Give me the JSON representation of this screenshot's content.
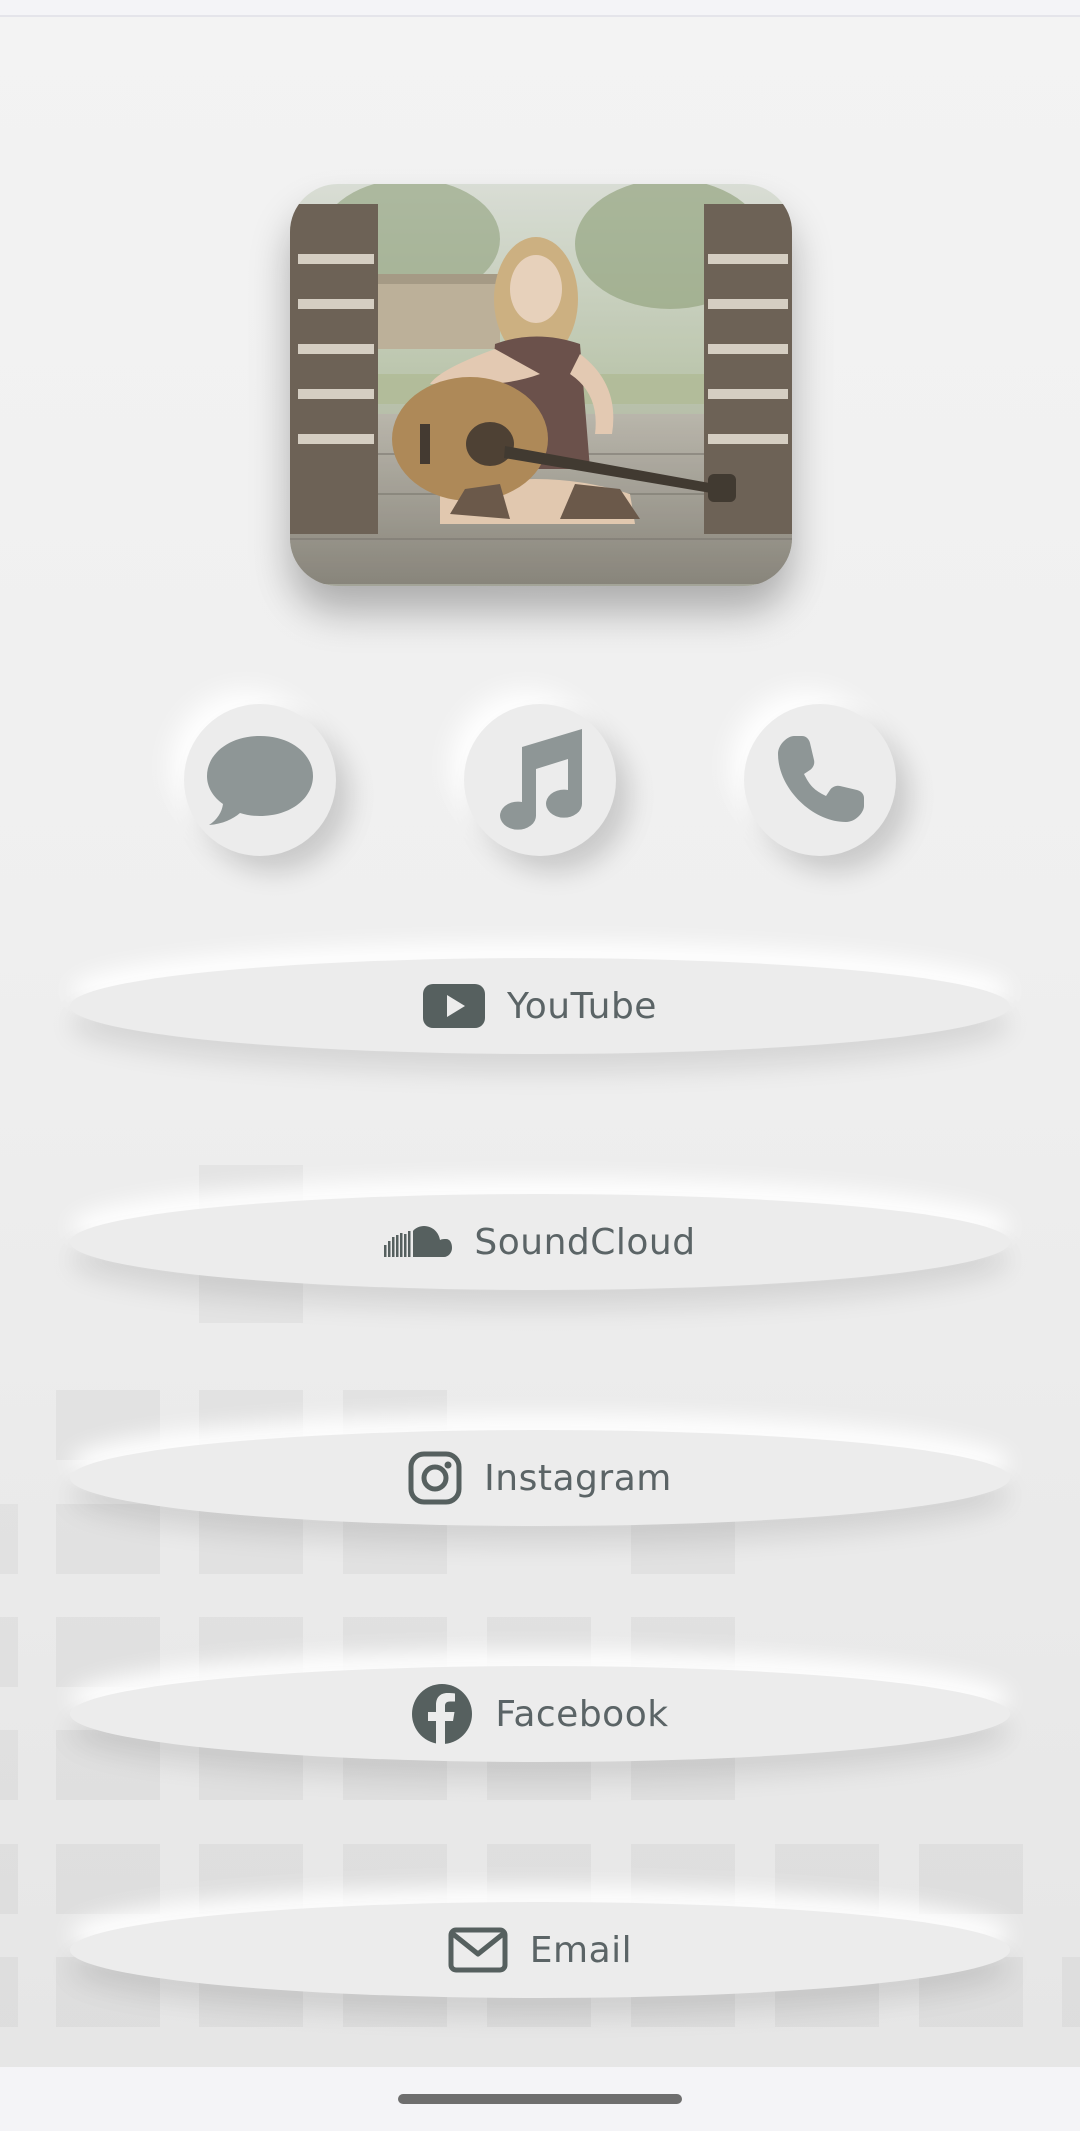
{
  "contact_buttons": [
    {
      "icon": "chat-bubble-icon"
    },
    {
      "icon": "music-note-icon"
    },
    {
      "icon": "phone-icon"
    }
  ],
  "links": [
    {
      "label": "YouTube",
      "icon": "youtube-icon"
    },
    {
      "label": "SoundCloud",
      "icon": "soundcloud-icon"
    },
    {
      "label": "Instagram",
      "icon": "instagram-icon"
    },
    {
      "label": "Facebook",
      "icon": "facebook-icon"
    },
    {
      "label": "Email",
      "icon": "envelope-icon"
    }
  ],
  "colors": {
    "background": "#f2f2f3",
    "button_surface": "#ececec",
    "icon_gray": "#8e9696",
    "icon_dark": "#56605f",
    "text": "#5b6466"
  }
}
